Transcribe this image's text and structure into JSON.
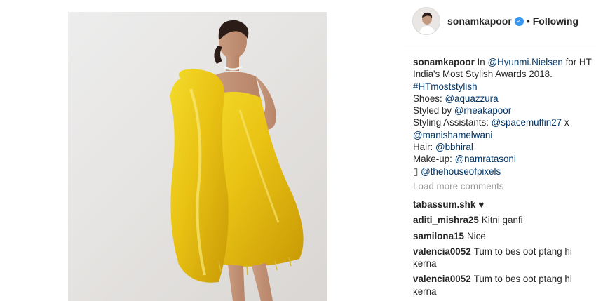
{
  "post": {
    "author": "sonamkapoor",
    "verified": true,
    "separator": "•",
    "follow_status": "Following",
    "image_description": "woman in yellow satin bow dress",
    "accent_color": "#3897f0",
    "link_color": "#003569"
  },
  "caption": {
    "author": "sonamkapoor",
    "intro": "In",
    "mention_1": "@Hyunmi.Nielsen",
    "text_1": "for HT",
    "line_2": "India's Most Stylish Awards 2018.",
    "hashtag": "#HTmoststylish",
    "shoes_label": "Shoes:",
    "shoes_mention": "@aquazzura",
    "styled_label": "Styled by",
    "styled_mention": "@rheakapoor",
    "assist_label": "Styling Assistants:",
    "assist_mention_1": "@spacemuffin27",
    "assist_x": "x",
    "assist_mention_2": "@manishamelwani",
    "hair_label": "Hair:",
    "hair_mention": "@bbhiral",
    "makeup_label": "Make-up:",
    "makeup_mention": "@namratasoni",
    "camera_glyph": "▯",
    "photo_mention": "@thehouseofpixels"
  },
  "load_more": "Load more comments",
  "comments": [
    {
      "user": "tabassum.shk",
      "text": "♥"
    },
    {
      "user": "aditi_mishra25",
      "text": "Kitni ganfi"
    },
    {
      "user": "samilona15",
      "text": "Nice"
    },
    {
      "user": "valencia0052",
      "text": "Tum to bes oot ptang hi kerna"
    },
    {
      "user": "valencia0052",
      "text": "Tum to bes oot ptang hi kerna"
    }
  ]
}
